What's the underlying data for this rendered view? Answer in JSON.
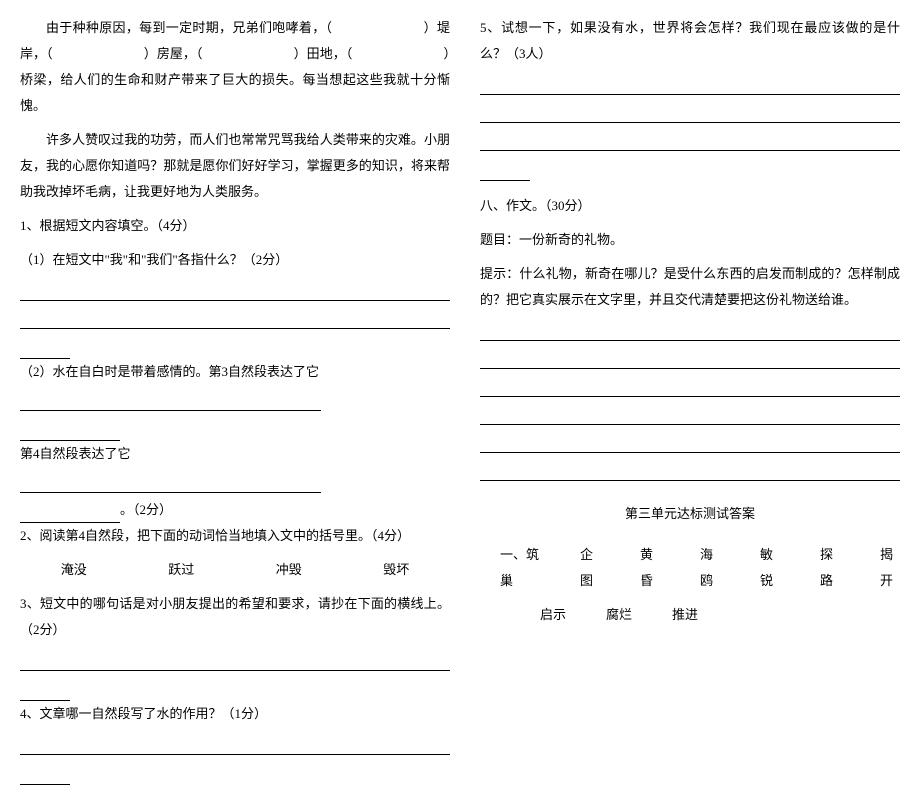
{
  "left": {
    "p1_a": "由于种种原因，每到一定时期，兄弟们咆哮着，（",
    "p1_b": "）堤岸，",
    "p1_c": "（",
    "p1_d": "）房屋，（",
    "p1_e": "）田地，（",
    "p1_f": "）桥梁，给人们的生命和财产带来了巨大的损失。每当想起这些我就十分惭愧。",
    "p2": "许多人赞叹过我的功劳，而人们也常常咒骂我给人类带来的灾难。小朋友，我的心愿你知道吗？那就是愿你们好好学习，掌握更多的知识，将来帮助我改掉坏毛病，让我更好地为人类服务。",
    "q1": "1、根据短文内容填空。（4分）",
    "q1_1": "（1）在短文中\"我\"和\"我们\"各指什么？（2分）",
    "q1_2": "（2）水在自白时是带着感情的。第3自然段表达了它",
    "q1_2b": "第4自然段表达了它",
    "q1_2_suffix": "。（2分）",
    "q2": "2、阅读第4自然段，把下面的动词恰当地填入文中的括号里。（4分）",
    "verbs": [
      "淹没",
      "跃过",
      "冲毁",
      "毁坏"
    ],
    "q3": "3、短文中的哪句话是对小朋友提出的希望和要求，请抄在下面的横线上。（2分）",
    "q4": "4、文章哪一自然段写了水的作用？（1分）"
  },
  "right": {
    "q5": "5、试想一下，如果没有水，世界将会怎样？我们现在最应该做的是什么？（3人）",
    "section8": "八、作文。（30分）",
    "topic_label": "题目：",
    "topic": "一份新奇的礼物。",
    "hint_label": "提示：",
    "hint": "什么礼物，新奇在哪儿？是受什么东西的启发而制成的？怎样制成的？把它真实展示在文字里，并且交代清楚要把这份礼物送给谁。",
    "answer_title": "第三单元达标测试答案",
    "ans1_label": "一、",
    "ans1": [
      "筑巢",
      "企图",
      "黄昏",
      "海鸥",
      "敏锐",
      "探路",
      "揭开"
    ],
    "ans2": [
      "启示",
      "腐烂",
      "推进"
    ]
  }
}
